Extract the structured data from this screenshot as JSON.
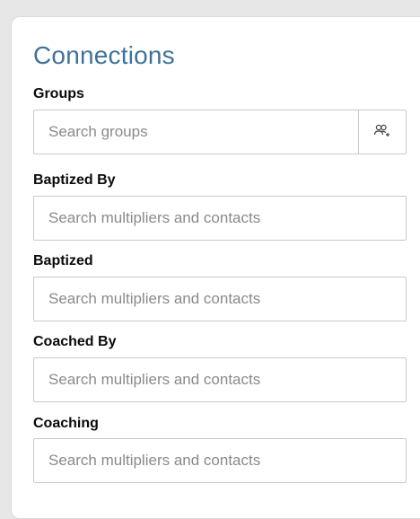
{
  "section": {
    "title": "Connections"
  },
  "fields": [
    {
      "label": "Groups",
      "placeholder": "Search groups",
      "addon_icon": "add-group-icon"
    },
    {
      "label": "Baptized By",
      "placeholder": "Search multipliers and contacts"
    },
    {
      "label": "Baptized",
      "placeholder": "Search multipliers and contacts"
    },
    {
      "label": "Coached By",
      "placeholder": "Search multipliers and contacts"
    },
    {
      "label": "Coaching",
      "placeholder": "Search multipliers and contacts"
    }
  ],
  "colors": {
    "title": "#3f729b",
    "border": "#cacaca",
    "background": "#e7e7e7"
  }
}
